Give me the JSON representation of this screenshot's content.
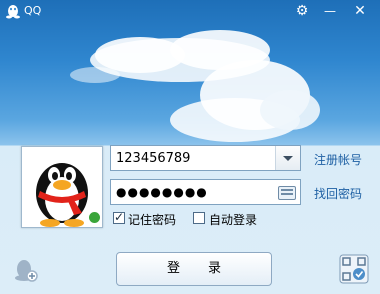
{
  "window": {
    "title": "QQ"
  },
  "titlebar": {
    "settings_glyph": "⚙",
    "minimize_glyph": "—",
    "close_glyph": "✕"
  },
  "login": {
    "account_value": "123456789",
    "password_value": "●●●●●●●●",
    "register_link": "注册帐号",
    "recover_link": "找回密码",
    "remember_label": "记住密码",
    "remember_checked": true,
    "auto_login_label": "自动登录",
    "auto_login_checked": false,
    "login_button": "登录"
  },
  "icons": {
    "logo": "qq-penguin-icon",
    "add_account": "add-account-icon",
    "qr": "qr-code-login-icon",
    "keyboard": "soft-keyboard-icon"
  },
  "colors": {
    "sky_top": "#1e6fb8",
    "panel": "#dcedf8",
    "link": "#1d5fa3"
  }
}
